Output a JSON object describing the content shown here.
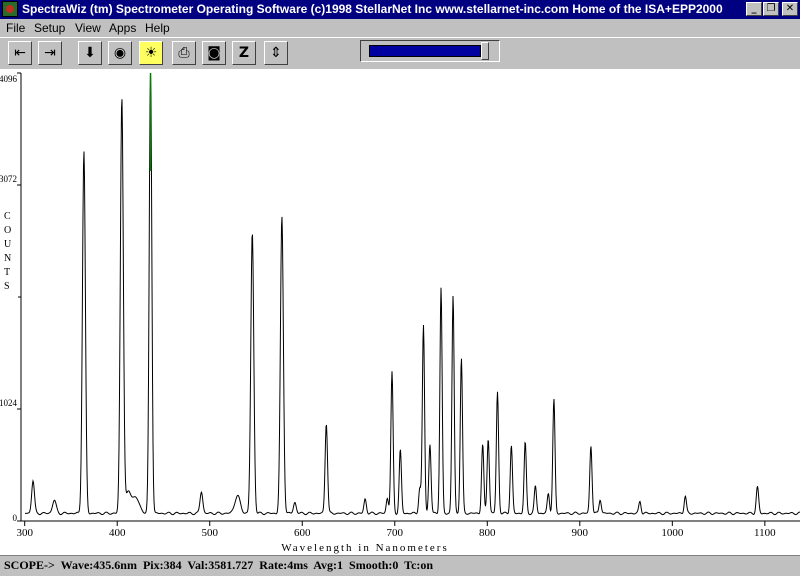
{
  "titlebar": {
    "title": "SpectraWiz (tm) Spectrometer Operating Software   (c)1998 StellarNet Inc   www.stellarnet-inc.com   Home of the ISA+EPP2000",
    "minimize": "_",
    "restore": "❐",
    "close": "✕"
  },
  "menu": [
    "File",
    "Setup",
    "View",
    "Apps",
    "Help"
  ],
  "toolbar": {
    "icons": [
      "move-left-icon",
      "move-right-icon",
      "download-icon",
      "dark-bulb-icon",
      "light-bulb-icon",
      "print-icon",
      "snapshot-icon",
      "zero-icon",
      "scale-icon"
    ],
    "symbols": [
      "⇤",
      "⇥",
      "⬇",
      "◉",
      "☀",
      "⎙",
      "◙",
      "Z",
      "⇕"
    ],
    "slider_fraction": 0.92
  },
  "chart_data": {
    "type": "line",
    "title": "",
    "xlabel": "Wavelength in Nanometers",
    "ylabel": "COUNTS",
    "xlim": [
      296,
      1138
    ],
    "ylim": [
      0,
      4096
    ],
    "xticks": [
      300,
      400,
      500,
      600,
      700,
      800,
      900,
      1000,
      1100
    ],
    "yticks": [
      0,
      1024,
      3072,
      4096
    ],
    "ytick_labels": [
      "0",
      "1024",
      "3072",
      "4096"
    ],
    "baseline": 70,
    "peaks": [
      {
        "x": 309,
        "y": 300,
        "w": 1.5
      },
      {
        "x": 332,
        "y": 120,
        "w": 2
      },
      {
        "x": 364,
        "y": 3310,
        "w": 1.6
      },
      {
        "x": 405,
        "y": 3800,
        "w": 1.6
      },
      {
        "x": 412,
        "y": 180,
        "w": 3
      },
      {
        "x": 420,
        "y": 140,
        "w": 4
      },
      {
        "x": 436,
        "y": 4096,
        "w": 1.4
      },
      {
        "x": 491,
        "y": 200,
        "w": 1.5
      },
      {
        "x": 530,
        "y": 160,
        "w": 3
      },
      {
        "x": 546,
        "y": 2570,
        "w": 1.6
      },
      {
        "x": 578,
        "y": 2710,
        "w": 1.6
      },
      {
        "x": 592,
        "y": 100,
        "w": 1.5
      },
      {
        "x": 626,
        "y": 830,
        "w": 1.3
      },
      {
        "x": 668,
        "y": 130,
        "w": 1.3
      },
      {
        "x": 692,
        "y": 140,
        "w": 1.2
      },
      {
        "x": 697,
        "y": 1290,
        "w": 1.2
      },
      {
        "x": 706,
        "y": 580,
        "w": 1.2
      },
      {
        "x": 727,
        "y": 230,
        "w": 1.2
      },
      {
        "x": 731,
        "y": 1720,
        "w": 1.2
      },
      {
        "x": 738,
        "y": 630,
        "w": 1.2
      },
      {
        "x": 750,
        "y": 2060,
        "w": 1.2
      },
      {
        "x": 763,
        "y": 1990,
        "w": 1.2
      },
      {
        "x": 772,
        "y": 1420,
        "w": 1.2
      },
      {
        "x": 795,
        "y": 630,
        "w": 1.2
      },
      {
        "x": 801,
        "y": 690,
        "w": 1.2
      },
      {
        "x": 811,
        "y": 1110,
        "w": 1.2
      },
      {
        "x": 826,
        "y": 620,
        "w": 1.2
      },
      {
        "x": 841,
        "y": 650,
        "w": 1.2
      },
      {
        "x": 852,
        "y": 250,
        "w": 1.2
      },
      {
        "x": 866,
        "y": 180,
        "w": 1.2
      },
      {
        "x": 872,
        "y": 1040,
        "w": 1.2
      },
      {
        "x": 912,
        "y": 620,
        "w": 1.2
      },
      {
        "x": 922,
        "y": 130,
        "w": 1.2
      },
      {
        "x": 965,
        "y": 110,
        "w": 1.2
      },
      {
        "x": 1014,
        "y": 160,
        "w": 1.2
      },
      {
        "x": 1092,
        "y": 240,
        "w": 1.3
      }
    ],
    "highlight": {
      "x": 436,
      "color": "#008000"
    },
    "line_color": "#000000"
  },
  "status": "SCOPE->  Wave:435.6nm  Pix:384  Val:3581.727  Rate:4ms  Avg:1  Smooth:0  Tc:on"
}
